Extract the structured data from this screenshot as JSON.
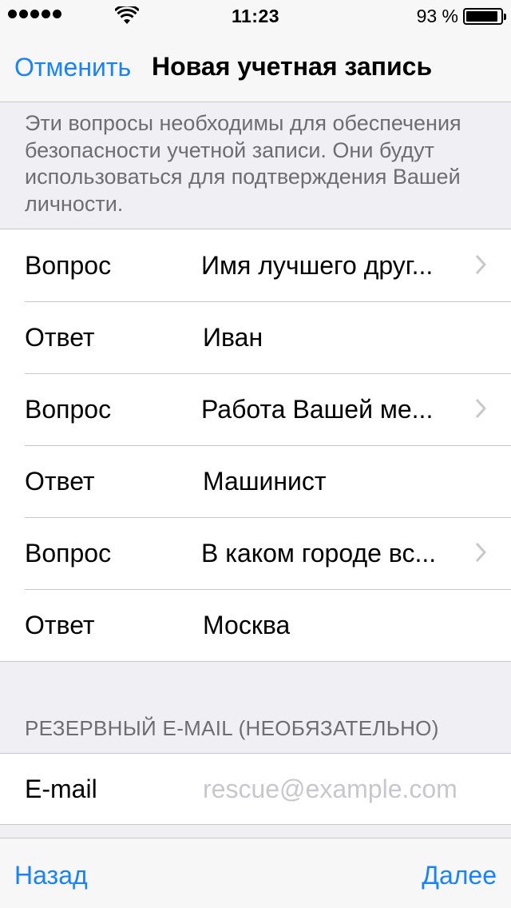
{
  "status_bar": {
    "time": "11:23",
    "battery_percent": "93 %",
    "signal_icon": "signal-dots-icon",
    "wifi_icon": "wifi-icon",
    "battery_icon": "battery-icon"
  },
  "nav": {
    "cancel_label": "Отменить",
    "title": "Новая учетная запись"
  },
  "description": "Эти вопросы необходимы для обеспечения безопасности учетной записи. Они будут использоваться для подтверждения Вашей личности.",
  "security_questions": [
    {
      "label": "Вопрос",
      "value": "Имя лучшего друг...",
      "chevron": true
    },
    {
      "label": "Ответ",
      "value": "Иван",
      "chevron": false
    },
    {
      "label": "Вопрос",
      "value": "Работа Вашей ме...",
      "chevron": true
    },
    {
      "label": "Ответ",
      "value": "Машинист",
      "chevron": false
    },
    {
      "label": "Вопрос",
      "value": "В каком городе вс...",
      "chevron": true
    },
    {
      "label": "Ответ",
      "value": "Москва",
      "chevron": false
    }
  ],
  "rescue_section": {
    "header": "РЕЗЕРВНЫЙ E-MAIL (НЕОБЯЗАТЕЛЬНО)",
    "email_label": "E-mail",
    "email_placeholder": "rescue@example.com",
    "email_value": ""
  },
  "toolbar": {
    "back_label": "Назад",
    "next_label": "Далее"
  },
  "colors": {
    "accent": "#1a82fb",
    "background": "#efeff4",
    "separator": "#c8c7cc",
    "secondary_text": "#6d6d72",
    "placeholder": "#c7c7cd"
  }
}
